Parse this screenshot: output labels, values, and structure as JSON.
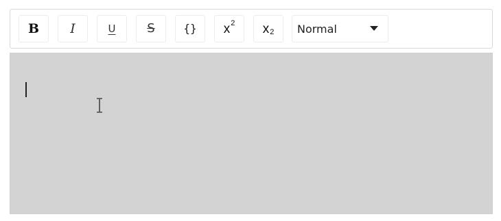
{
  "toolbar": {
    "bold": {
      "label": "B",
      "icon": "bold-icon"
    },
    "italic": {
      "label": "I",
      "icon": "italic-icon"
    },
    "underline": {
      "label": "U",
      "icon": "underline-icon"
    },
    "strike": {
      "label": "S",
      "icon": "strikethrough-icon"
    },
    "code": {
      "label": "{}",
      "icon": "code-icon"
    },
    "superscript": {
      "base": "x",
      "script": "2",
      "icon": "superscript-icon"
    },
    "subscript": {
      "base": "x",
      "script": "2",
      "icon": "subscript-icon"
    },
    "format_select": {
      "value": "Normal",
      "icon": "caret-down-icon"
    }
  },
  "editor": {
    "content": "",
    "background": "#d3d3d3"
  }
}
